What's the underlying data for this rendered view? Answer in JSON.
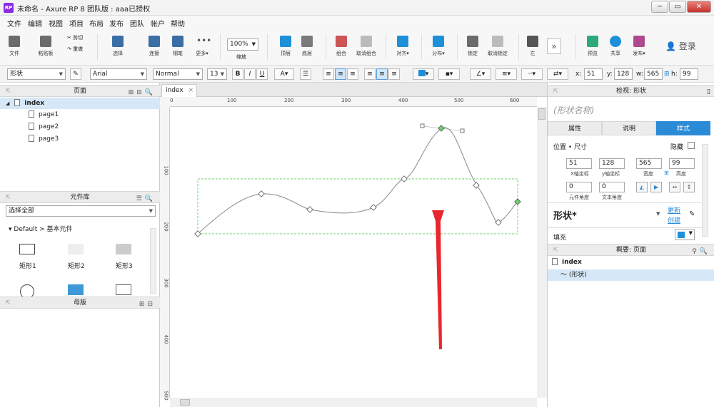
{
  "window": {
    "title": "未命名 - Axure RP 8 团队版 : aaa已授权",
    "app_icon": "RP"
  },
  "menu": [
    "文件",
    "编辑",
    "视图",
    "项目",
    "布局",
    "发布",
    "团队",
    "帐户",
    "帮助"
  ],
  "toolbar": {
    "file_label": "文件",
    "paste_label": "粘贴板",
    "cut_label": "剪切",
    "redo_label": "重做",
    "select_label": "选择",
    "connect_label": "连接",
    "pen_label": "钢笔",
    "more_label": "更多▾",
    "zoom_value": "100%",
    "zoom_label": "缩放",
    "top_label": "顶层",
    "bottom_label": "底层",
    "group_label": "组合",
    "ungroup_label": "取消组合",
    "align_label": "对齐▾",
    "distribute_label": "分布▾",
    "lock_label": "锁定",
    "unlock_label": "取消锁定",
    "left_label": "左",
    "preview_label": "预览",
    "share_label": "共享",
    "publish_label": "发布▾",
    "login_label": "登录"
  },
  "format": {
    "shape_type": "形状",
    "font": "Arial",
    "style": "Normal",
    "size": "13",
    "bold": "B",
    "italic": "I",
    "underline": "U",
    "x_label": "x:",
    "x": "51",
    "y_label": "y:",
    "y": "128",
    "w_label": "w:",
    "w": "565",
    "h_label": "h:",
    "h": "99"
  },
  "left": {
    "pages_header": "页面",
    "pages": [
      "index",
      "page1",
      "page2",
      "page3"
    ],
    "widgets_header": "元件库",
    "library_select": "选择全部",
    "library_path": "Default > 基本元件",
    "widgets": [
      "矩形1",
      "矩形2",
      "矩形3"
    ],
    "masters_header": "母版"
  },
  "canvas": {
    "tab": "index",
    "hruler": [
      "0",
      "100",
      "200",
      "300",
      "400",
      "500",
      "600"
    ],
    "vruler": [
      "100",
      "200",
      "300",
      "400",
      "500"
    ]
  },
  "right": {
    "header": "检视: 形状",
    "shape_name_placeholder": "(形状名称)",
    "tabs": [
      "属性",
      "说明",
      "样式"
    ],
    "pos_size": "位置 • 尺寸",
    "hide": "隐藏",
    "x": "51",
    "x_label": "X轴坐标",
    "y": "128",
    "y_label": "y轴坐标",
    "w": "565",
    "w_label": "宽度",
    "h": "99",
    "h_label": "高度",
    "rot": "0",
    "rot_label": "元件角度",
    "text_rot": "0",
    "text_rot_label": "文本角度",
    "style_name": "形状*",
    "update": "更新",
    "create": "创建",
    "fill": "填充",
    "outline_header": "概要: 页面",
    "outline_page": "index",
    "outline_item": "(形状)"
  },
  "colors": {
    "accent": "#2b8ad6",
    "selection": "#6cd16c",
    "arrow": "#e8262d",
    "fill_swatch": "#1e90d8"
  }
}
